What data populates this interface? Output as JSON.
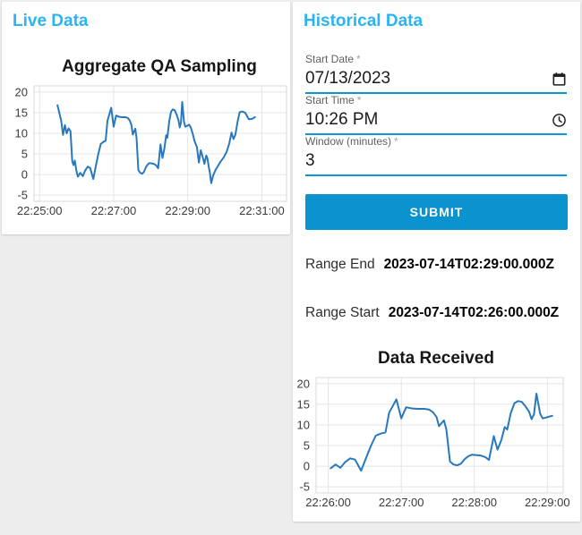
{
  "colors": {
    "page_background": "#ededed",
    "card_background": "#ffffff",
    "accent_heading_blue": "#2bb3f3",
    "input_underline_blue": "#0f95d3",
    "submit_button_blue": "#0a93cf",
    "chart_line_blue": "#2778be"
  },
  "live_panel": {
    "title": "Live Data"
  },
  "historical_panel": {
    "title": "Historical Data",
    "form": {
      "start_date": {
        "label": "Start Date",
        "required_marker": "*",
        "value": "07/13/2023",
        "icon": "calendar-icon"
      },
      "start_time": {
        "label": "Start Time",
        "required_marker": "*",
        "value": "10:26 PM",
        "icon": "clock-icon"
      },
      "window": {
        "label": "Window (minutes)",
        "required_marker": "*",
        "value": "3"
      },
      "submit_label": "SUBMIT"
    },
    "results": {
      "range_end": {
        "label": "Range End",
        "value": "2023-07-14T02:29:00.000Z"
      },
      "range_start": {
        "label": "Range Start",
        "value": "2023-07-14T02:26:00.000Z"
      }
    }
  },
  "chart_data": [
    {
      "id": "live",
      "type": "line",
      "title": "Aggregate QA Sampling",
      "xlabel": "",
      "ylabel": "",
      "grid": true,
      "legend": "none",
      "x_axis": {
        "tick_labels": [
          "22:25:00",
          "22:27:00",
          "22:29:00",
          "22:31:00"
        ],
        "tick_seconds": [
          0,
          120,
          240,
          360
        ],
        "domain_seconds": [
          -9,
          400
        ]
      },
      "y_axis": {
        "ticks": [
          -5,
          0,
          5,
          10,
          15,
          20
        ],
        "domain": [
          -6.5,
          21.5
        ],
        "ylim": [
          -5,
          20
        ]
      },
      "line_color": "#2778be",
      "points": [
        [
          29,
          16.8
        ],
        [
          32,
          14.9
        ],
        [
          35,
          13.1
        ],
        [
          38,
          9.6
        ],
        [
          41,
          12.0
        ],
        [
          44,
          10.0
        ],
        [
          47,
          11.2
        ],
        [
          50,
          10.5
        ],
        [
          53,
          3.2
        ],
        [
          55,
          2.3
        ],
        [
          57,
          3.4
        ],
        [
          60,
          0.6
        ],
        [
          62,
          -0.5
        ],
        [
          66,
          0.4
        ],
        [
          70,
          -0.4
        ],
        [
          74,
          1.0
        ],
        [
          78,
          1.9
        ],
        [
          82,
          1.6
        ],
        [
          87,
          -1.1
        ],
        [
          91,
          1.9
        ],
        [
          95,
          4.9
        ],
        [
          99,
          7.4
        ],
        [
          103,
          7.9
        ],
        [
          107,
          8.2
        ],
        [
          110,
          13.0
        ],
        [
          113,
          14.6
        ],
        [
          116,
          16.2
        ],
        [
          120,
          11.6
        ],
        [
          124,
          14.3
        ],
        [
          129,
          14.0
        ],
        [
          134,
          13.9
        ],
        [
          139,
          13.9
        ],
        [
          143,
          13.7
        ],
        [
          146,
          13.1
        ],
        [
          149,
          11.9
        ],
        [
          151,
          9.7
        ],
        [
          153,
          10.4
        ],
        [
          155,
          11.1
        ],
        [
          157,
          8.9
        ],
        [
          160,
          1.1
        ],
        [
          163,
          0.4
        ],
        [
          166,
          0.2
        ],
        [
          169,
          0.6
        ],
        [
          172,
          1.7
        ],
        [
          175,
          2.4
        ],
        [
          178,
          2.8
        ],
        [
          181,
          2.7
        ],
        [
          185,
          2.6
        ],
        [
          189,
          2.2
        ],
        [
          192,
          1.5
        ],
        [
          196,
          7.3
        ],
        [
          199,
          4.0
        ],
        [
          202,
          6.2
        ],
        [
          205,
          9.5
        ],
        [
          207,
          8.9
        ],
        [
          210,
          12.9
        ],
        [
          213,
          15.3
        ],
        [
          216,
          15.8
        ],
        [
          219,
          15.6
        ],
        [
          222,
          14.5
        ],
        [
          225,
          13.2
        ],
        [
          227,
          11.4
        ],
        [
          229,
          12.6
        ],
        [
          231,
          17.6
        ],
        [
          234,
          12.8
        ],
        [
          236,
          11.6
        ],
        [
          239,
          11.8
        ],
        [
          242,
          12.1
        ],
        [
          245,
          11.4
        ],
        [
          248,
          9.9
        ],
        [
          251,
          8.1
        ],
        [
          255,
          6.6
        ],
        [
          258,
          2.9
        ],
        [
          261,
          5.9
        ],
        [
          264,
          4.4
        ],
        [
          267,
          2.6
        ],
        [
          270,
          4.6
        ],
        [
          272,
          3.9
        ],
        [
          274,
          1.9
        ],
        [
          276,
          0.3
        ],
        [
          278,
          -2.1
        ],
        [
          281,
          -0.3
        ],
        [
          285,
          1.1
        ],
        [
          289,
          2.1
        ],
        [
          293,
          3.1
        ],
        [
          298,
          4.1
        ],
        [
          303,
          5.5
        ],
        [
          307,
          7.4
        ],
        [
          311,
          10.2
        ],
        [
          314,
          8.6
        ],
        [
          317,
          9.6
        ],
        [
          321,
          13.0
        ],
        [
          324,
          15.1
        ],
        [
          328,
          15.3
        ],
        [
          333,
          15.0
        ],
        [
          339,
          13.4
        ],
        [
          344,
          13.5
        ],
        [
          349,
          13.9
        ]
      ]
    },
    {
      "id": "historical",
      "type": "line",
      "title": "Data Received",
      "xlabel": "",
      "ylabel": "",
      "grid": true,
      "legend": "none",
      "x_axis": {
        "tick_labels": [
          "22:26:00",
          "22:27:00",
          "22:28:00",
          "22:29:00"
        ],
        "tick_seconds": [
          0,
          60,
          120,
          180
        ],
        "domain_seconds": [
          -10,
          193
        ]
      },
      "y_axis": {
        "ticks": [
          -5,
          0,
          5,
          10,
          15,
          20
        ],
        "domain": [
          -6.5,
          21.5
        ],
        "ylim": [
          -5,
          20
        ]
      },
      "line_color": "#2778be",
      "points": [
        [
          2,
          -0.5
        ],
        [
          6,
          0.4
        ],
        [
          10,
          -0.4
        ],
        [
          14,
          1.0
        ],
        [
          18,
          1.9
        ],
        [
          22,
          1.6
        ],
        [
          27,
          -1.1
        ],
        [
          31,
          1.9
        ],
        [
          35,
          4.9
        ],
        [
          39,
          7.4
        ],
        [
          43,
          7.9
        ],
        [
          47,
          8.2
        ],
        [
          50,
          13.0
        ],
        [
          53,
          14.6
        ],
        [
          56,
          16.2
        ],
        [
          60,
          11.6
        ],
        [
          64,
          14.3
        ],
        [
          69,
          14.0
        ],
        [
          74,
          13.9
        ],
        [
          79,
          13.9
        ],
        [
          83,
          13.7
        ],
        [
          86,
          13.1
        ],
        [
          89,
          11.9
        ],
        [
          91,
          9.7
        ],
        [
          93,
          10.4
        ],
        [
          95,
          11.1
        ],
        [
          97,
          8.9
        ],
        [
          100,
          1.1
        ],
        [
          103,
          0.4
        ],
        [
          106,
          0.2
        ],
        [
          109,
          0.6
        ],
        [
          112,
          1.7
        ],
        [
          115,
          2.4
        ],
        [
          118,
          2.8
        ],
        [
          121,
          2.7
        ],
        [
          125,
          2.6
        ],
        [
          129,
          2.2
        ],
        [
          132,
          1.5
        ],
        [
          136,
          7.3
        ],
        [
          139,
          4.0
        ],
        [
          142,
          6.2
        ],
        [
          145,
          9.5
        ],
        [
          147,
          8.9
        ],
        [
          150,
          12.9
        ],
        [
          153,
          15.3
        ],
        [
          156,
          15.8
        ],
        [
          159,
          15.6
        ],
        [
          162,
          14.5
        ],
        [
          165,
          13.2
        ],
        [
          167,
          11.4
        ],
        [
          169,
          12.6
        ],
        [
          171,
          17.6
        ],
        [
          174,
          12.8
        ],
        [
          176,
          11.6
        ],
        [
          179,
          11.8
        ],
        [
          181,
          12.0
        ],
        [
          184,
          12.2
        ]
      ]
    }
  ]
}
